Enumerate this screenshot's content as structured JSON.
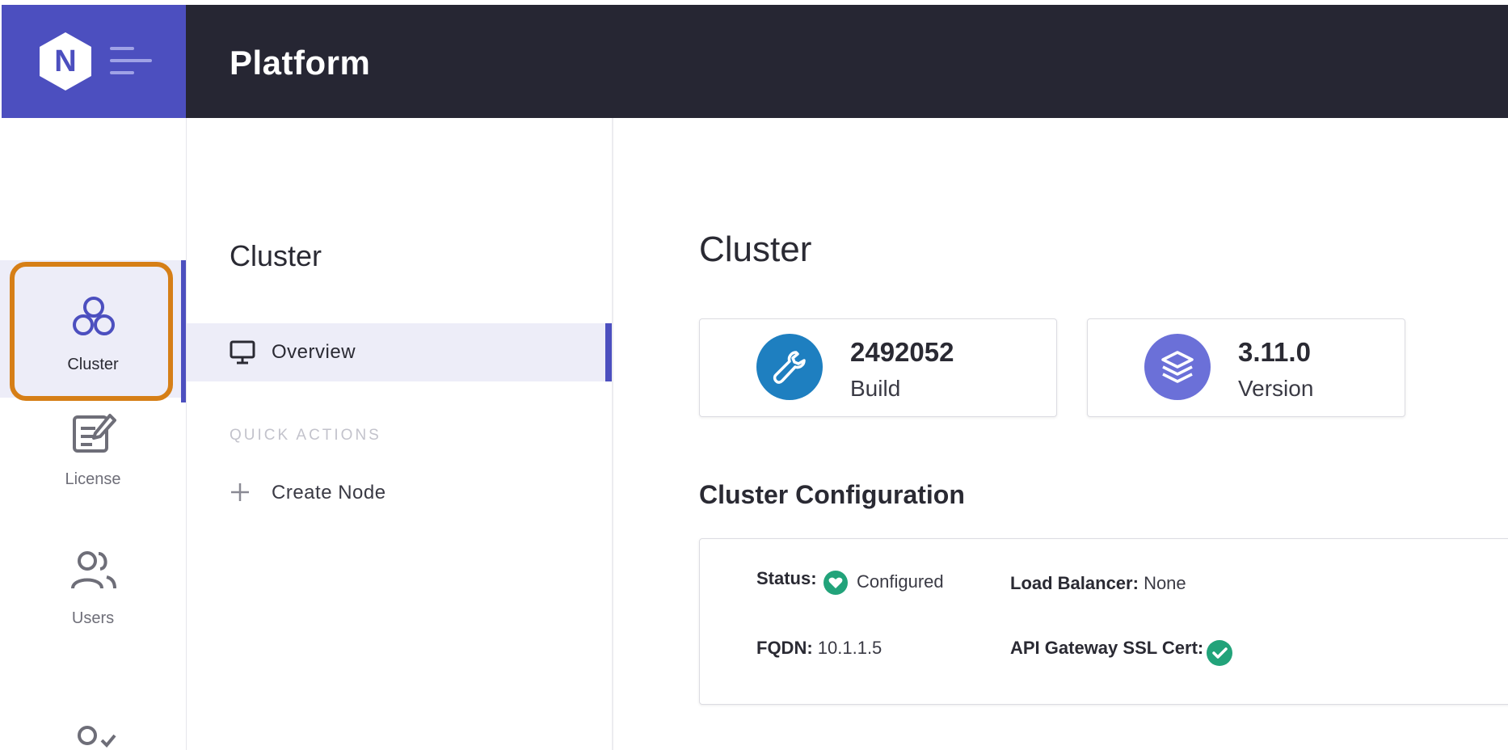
{
  "header": {
    "app_title": "Platform",
    "logo_letter": "N",
    "brand_color": "#4c4fbf",
    "bar_color": "#262633"
  },
  "rail": {
    "items": [
      {
        "label": "Cluster",
        "icon": "cluster-icon",
        "active": true
      },
      {
        "label": "License",
        "icon": "license-icon",
        "active": false
      },
      {
        "label": "Users",
        "icon": "users-icon",
        "active": false
      },
      {
        "label": "",
        "icon": "user-check-icon",
        "active": false
      }
    ],
    "highlight_color": "#d67f17"
  },
  "subnav": {
    "heading": "Cluster",
    "items": [
      {
        "label": "Overview",
        "icon": "monitor-icon",
        "active": true
      }
    ],
    "quick_actions_label": "QUICK ACTIONS",
    "quick_actions": [
      {
        "label": "Create Node",
        "icon": "plus-icon"
      }
    ]
  },
  "main": {
    "heading": "Cluster",
    "cards": [
      {
        "value": "2492052",
        "caption": "Build",
        "icon": "wrench-icon",
        "color": "#1e7fc0"
      },
      {
        "value": "3.11.0",
        "caption": "Version",
        "icon": "layers-icon",
        "color": "#6b70d8"
      }
    ],
    "config": {
      "title": "Cluster Configuration",
      "status_label": "Status:",
      "status_value": "Configured",
      "status_icon": "heart-icon",
      "status_color": "#22a37a",
      "load_balancer_label": "Load Balancer:",
      "load_balancer_value": "None",
      "fqdn_label": "FQDN:",
      "fqdn_value": "10.1.1.5",
      "ssl_label": "API Gateway SSL Cert:",
      "ssl_icon": "check-circle-icon"
    }
  }
}
